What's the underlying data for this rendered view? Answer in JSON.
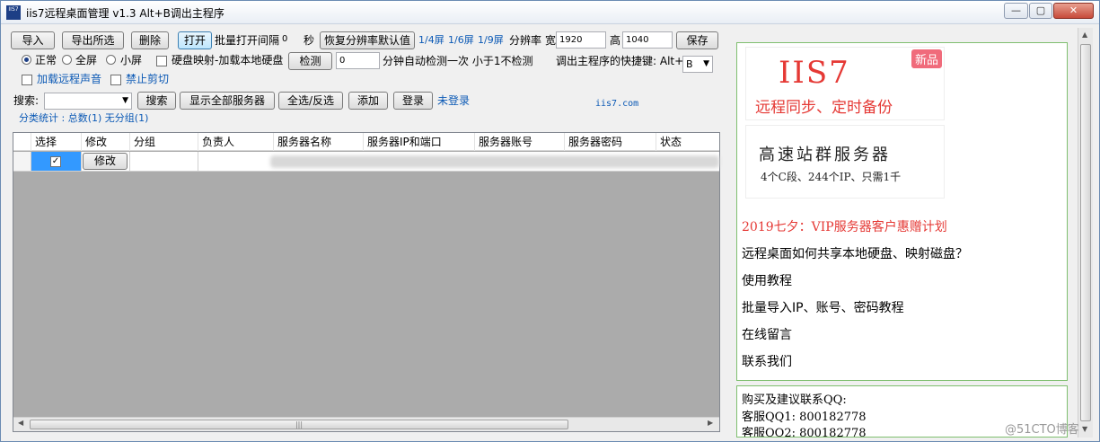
{
  "window": {
    "title": "iis7远程桌面管理 v1.3 Alt+B调出主程序",
    "icon_text": "IIS7",
    "min": "—",
    "max": "▢",
    "close": "✕"
  },
  "toolbar": {
    "import": "导入",
    "export_selected": "导出所选",
    "delete": "删除",
    "open": "打开",
    "batch_interval_label": "批量打开间隔",
    "batch_interval_value": "0",
    "seconds": "秒",
    "restore_resolution": "恢复分辨率默认值",
    "screen_quarter": "1/4屏",
    "screen_sixth": "1/6屏",
    "screen_ninth": "1/9屏",
    "resolution_label": "分辨率",
    "width_label": "宽",
    "width_value": "1920",
    "height_label": "高",
    "height_value": "1040",
    "save": "保存"
  },
  "options": {
    "normal": "正常",
    "fullscreen": "全屏",
    "small": "小屏",
    "disk_map": "硬盘映射-加载本地硬盘",
    "detect": "检测",
    "detect_value": "0",
    "detect_desc": "分钟自动检测一次 小于1不检测",
    "hotkey_label": "调出主程序的快捷键: Alt+",
    "hotkey_value": "B",
    "remote_sound": "加载远程声音",
    "no_clipboard": "禁止剪切"
  },
  "search": {
    "label": "搜索:",
    "button": "搜索",
    "show_all": "显示全部服务器",
    "select_all": "全选/反选",
    "add": "添加",
    "login": "登录",
    "not_logged": "未登录",
    "site": "iis7.com"
  },
  "stats": {
    "text": "分类统计 : 总数(1) 无分组(1)"
  },
  "table": {
    "headers": [
      "选择",
      "修改",
      "分组",
      "负责人",
      "服务器名称",
      "服务器IP和端口",
      "服务器账号",
      "服务器密码",
      "状态"
    ],
    "row": {
      "checked": "✓",
      "edit": "修改"
    },
    "hscroll_grip": "|||"
  },
  "ads": {
    "logo": "IIS7",
    "new_badge": "新品",
    "slogan": "远程同步、定时备份",
    "cluster_title": "高速站群服务器",
    "cluster_sub": "4个C段、244个IP、只需1千"
  },
  "links": [
    "2019七夕：VIP服务器客户惠赠计划",
    "远程桌面如何共享本地硬盘、映射磁盘？",
    "使用教程",
    "批量导入IP、账号、密码教程",
    "在线留言",
    "联系我们"
  ],
  "contact": {
    "title": "购买及建议联系QQ:",
    "qq1": "客服QQ1: 800182778",
    "qq2": "客服QQ2: 800182778"
  },
  "watermark": "@51CTO博客",
  "colors": {
    "accent": "#0b59b5",
    "promo": "#e53935",
    "panel_border": "#7fbf6f"
  }
}
